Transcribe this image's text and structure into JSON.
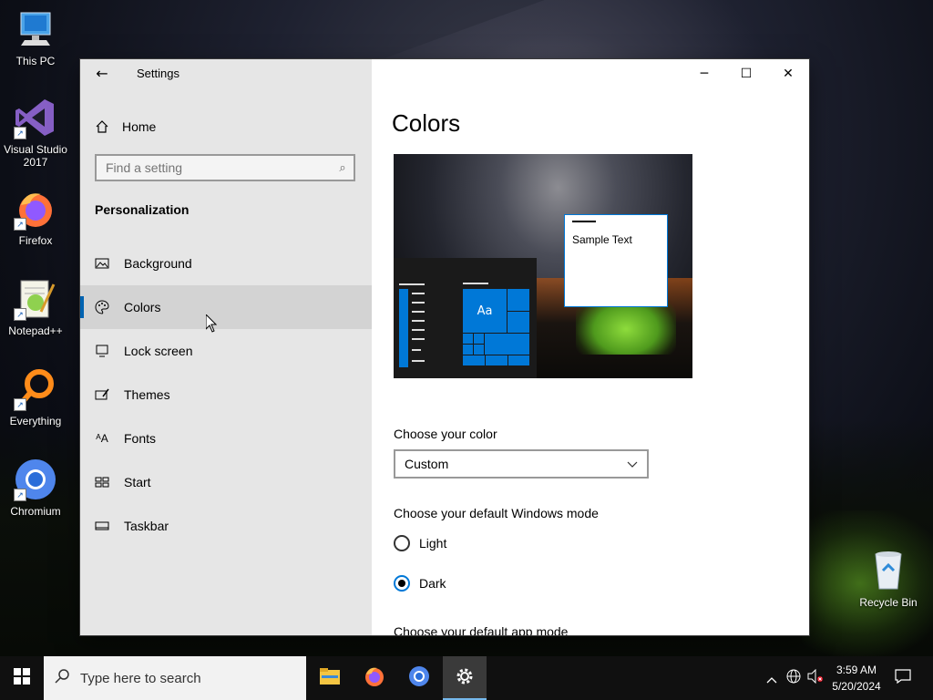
{
  "desktop": {
    "icons": [
      {
        "label": "This PC",
        "icon": "this-pc-icon"
      },
      {
        "label": "Visual Studio 2017",
        "icon": "visual-studio-icon"
      },
      {
        "label": "Firefox",
        "icon": "firefox-icon"
      },
      {
        "label": "Notepad++",
        "icon": "notepadpp-icon"
      },
      {
        "label": "Everything",
        "icon": "everything-icon"
      },
      {
        "label": "Chromium",
        "icon": "chromium-icon"
      }
    ],
    "recycle_bin": {
      "label": "Recycle Bin",
      "icon": "recycle-bin-icon"
    }
  },
  "window": {
    "title": "Settings",
    "controls": {
      "minimize": "─",
      "maximize": "☐",
      "close": "✕"
    }
  },
  "sidebar": {
    "home_label": "Home",
    "search_placeholder": "Find a setting",
    "section_title": "Personalization",
    "items": [
      {
        "label": "Background",
        "icon": "background-icon"
      },
      {
        "label": "Colors",
        "icon": "palette-icon",
        "active": true
      },
      {
        "label": "Lock screen",
        "icon": "lock-screen-icon"
      },
      {
        "label": "Themes",
        "icon": "themes-icon"
      },
      {
        "label": "Fonts",
        "icon": "fonts-icon"
      },
      {
        "label": "Start",
        "icon": "start-icon"
      },
      {
        "label": "Taskbar",
        "icon": "taskbar-icon"
      }
    ]
  },
  "main": {
    "title": "Colors",
    "preview": {
      "tile_text": "Aa",
      "sample_text": "Sample Text"
    },
    "choose_color_label": "Choose your color",
    "choose_color_value": "Custom",
    "windows_mode_label": "Choose your default Windows mode",
    "windows_mode_options": [
      {
        "label": "Light",
        "checked": false
      },
      {
        "label": "Dark",
        "checked": true
      }
    ],
    "app_mode_label": "Choose your default app mode"
  },
  "taskbar": {
    "search_placeholder": "Type here to search",
    "apps": [
      "file-explorer-icon",
      "firefox-icon",
      "chromium-icon",
      "settings-icon"
    ],
    "time": "3:59 AM",
    "date": "5/20/2024"
  },
  "colors": {
    "accent": "#0078d7",
    "sidebar_bg": "#e6e6e6",
    "taskbar_bg": "#101010"
  }
}
